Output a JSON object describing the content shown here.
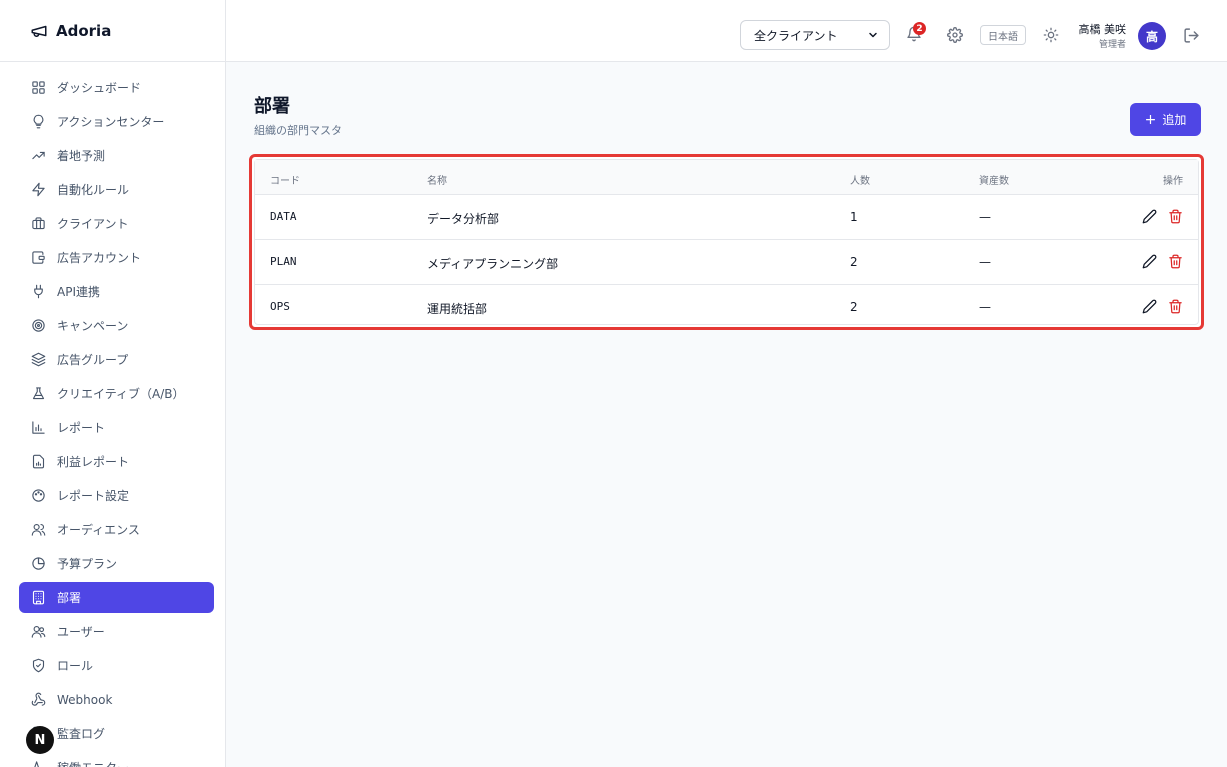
{
  "app": {
    "name": "Adoria"
  },
  "nav": {
    "items": [
      {
        "label": "ダッシュボード",
        "icon": "dashboard-icon",
        "active": false
      },
      {
        "label": "アクションセンター",
        "icon": "lightbulb-icon",
        "active": false
      },
      {
        "label": "着地予測",
        "icon": "trending-icon",
        "active": false
      },
      {
        "label": "自動化ルール",
        "icon": "bolt-icon",
        "active": false
      },
      {
        "label": "クライアント",
        "icon": "briefcase-icon",
        "active": false
      },
      {
        "label": "広告アカウント",
        "icon": "wallet-icon",
        "active": false
      },
      {
        "label": "API連携",
        "icon": "plug-icon",
        "active": false
      },
      {
        "label": "キャンペーン",
        "icon": "target-icon",
        "active": false
      },
      {
        "label": "広告グループ",
        "icon": "layers-icon",
        "active": false
      },
      {
        "label": "クリエイティブ（A/B）",
        "icon": "flask-icon",
        "active": false
      },
      {
        "label": "レポート",
        "icon": "bar-chart-icon",
        "active": false
      },
      {
        "label": "利益レポート",
        "icon": "file-chart-icon",
        "active": false
      },
      {
        "label": "レポート設定",
        "icon": "palette-icon",
        "active": false
      },
      {
        "label": "オーディエンス",
        "icon": "users-icon",
        "active": false
      },
      {
        "label": "予算プラン",
        "icon": "pie-chart-icon",
        "active": false
      },
      {
        "label": "部署",
        "icon": "building-icon",
        "active": true
      },
      {
        "label": "ユーザー",
        "icon": "user-group-icon",
        "active": false
      },
      {
        "label": "ロール",
        "icon": "shield-check-icon",
        "active": false
      },
      {
        "label": "Webhook",
        "icon": "webhook-icon",
        "active": false
      },
      {
        "label": "監査ログ",
        "icon": "log-icon",
        "active": false
      },
      {
        "label": "稼働モニター",
        "icon": "activity-icon",
        "active": false
      }
    ]
  },
  "topbar": {
    "client_select": "全クライアント",
    "notification_count": "2",
    "language": "日本語",
    "user_name": "高橋 美咲",
    "user_role": "管理者",
    "avatar_initial": "高"
  },
  "page": {
    "title": "部署",
    "subtitle": "組織の部門マスタ",
    "add_label": "追加",
    "add_symbol": "+"
  },
  "table": {
    "headers": {
      "code": "コード",
      "name": "名称",
      "members": "人数",
      "assets": "資産数",
      "actions": "操作"
    },
    "rows": [
      {
        "code": "DATA",
        "name": "データ分析部",
        "members": "1",
        "assets": "—"
      },
      {
        "code": "PLAN",
        "name": "メディアプランニング部",
        "members": "2",
        "assets": "—"
      },
      {
        "code": "OPS",
        "name": "運用統括部",
        "members": "2",
        "assets": "—"
      }
    ]
  },
  "overlay": {
    "dev_badge": "N"
  },
  "colors": {
    "accent": "#4f46e5",
    "danger": "#dc2626",
    "highlight": "#e53935"
  }
}
